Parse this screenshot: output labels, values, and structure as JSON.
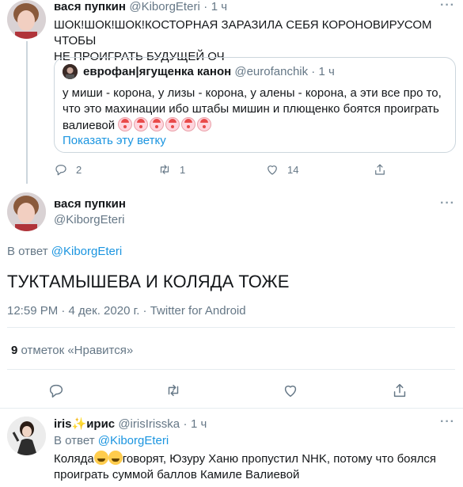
{
  "tweet1": {
    "name": "вася пупкин",
    "handle": "@KiborgEteri",
    "dot": "·",
    "time": "1 ч",
    "more": "···",
    "text_line1": "ШОК!ШОК!ШОК!КОСТОРНАЯ ЗАРАЗИЛА СЕБЯ КОРОНОВИРУСОМ ЧТОБЫ",
    "text_line2": "НЕ ПРОИГРАТЬ БУДУЩЕЙ ОЧ",
    "quote": {
      "name": "еврофан|ягущенка канон",
      "handle": "@eurofanchik",
      "dot": "·",
      "time": "1 ч",
      "text_line1": "у миши - корона, у лизы - корона, у алены - корона, а эти все про то,",
      "text_line2": "что это махинации ибо штабы мишин и плющенко боятся проиграть",
      "text_line3": "валиевой",
      "show_thread": "Показать эту ветку"
    },
    "replies": "2",
    "retweets": "1",
    "likes": "14"
  },
  "tweet2": {
    "name": "вася пупкин",
    "handle": "@KiborgEteri",
    "more": "···",
    "reply_prefix": "В ответ",
    "reply_to": "@KiborgEteri",
    "text": "ТУКТАМЫШЕВА И КОЛЯДА ТОЖЕ",
    "timestamp": "12:59 PM · 4 дек. 2020 г. · Twitter for Android",
    "likes_count": "9",
    "likes_label": "отметок «Нравится»"
  },
  "tweet3": {
    "name": "iris",
    "name_suffix": "ирис",
    "handle": "@irisIrisska",
    "dot": "·",
    "time": "1 ч",
    "more": "···",
    "reply_prefix": "В ответ",
    "reply_to": "@KiborgEteri",
    "text_line1_a": "Коляда",
    "text_line1_b": "говорят, Юзуру Ханю пропустил NHK, потому что боялся",
    "text_line2": "проиграть суммой баллов Камиле Валиевой"
  },
  "icons": [
    "reply-icon",
    "retweet-icon",
    "like-icon",
    "share-icon",
    "sparkles-icon",
    "clown-emoji",
    "cry-emoji"
  ]
}
